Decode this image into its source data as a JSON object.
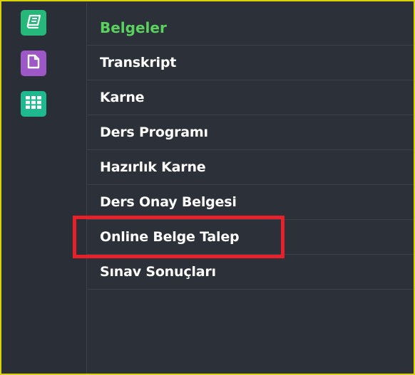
{
  "rail": {
    "buttons": [
      {
        "icon": "book-icon",
        "color": "#26b77a"
      },
      {
        "icon": "document-icon",
        "color": "#9d57c6"
      },
      {
        "icon": "grid-icon",
        "color": "#1fb98f"
      }
    ]
  },
  "menu": {
    "header": "Belgeler",
    "items": [
      {
        "label": "Transkript"
      },
      {
        "label": "Karne"
      },
      {
        "label": "Ders Programı"
      },
      {
        "label": "Hazırlık Karne"
      },
      {
        "label": "Ders Onay Belgesi"
      },
      {
        "label": "Online Belge Talep"
      },
      {
        "label": "Sınav Sonuçları"
      }
    ]
  },
  "colors": {
    "frame_border": "#d9d400",
    "background": "#2c3038",
    "header_text": "#5bd25f",
    "highlight": "#e8202a"
  }
}
